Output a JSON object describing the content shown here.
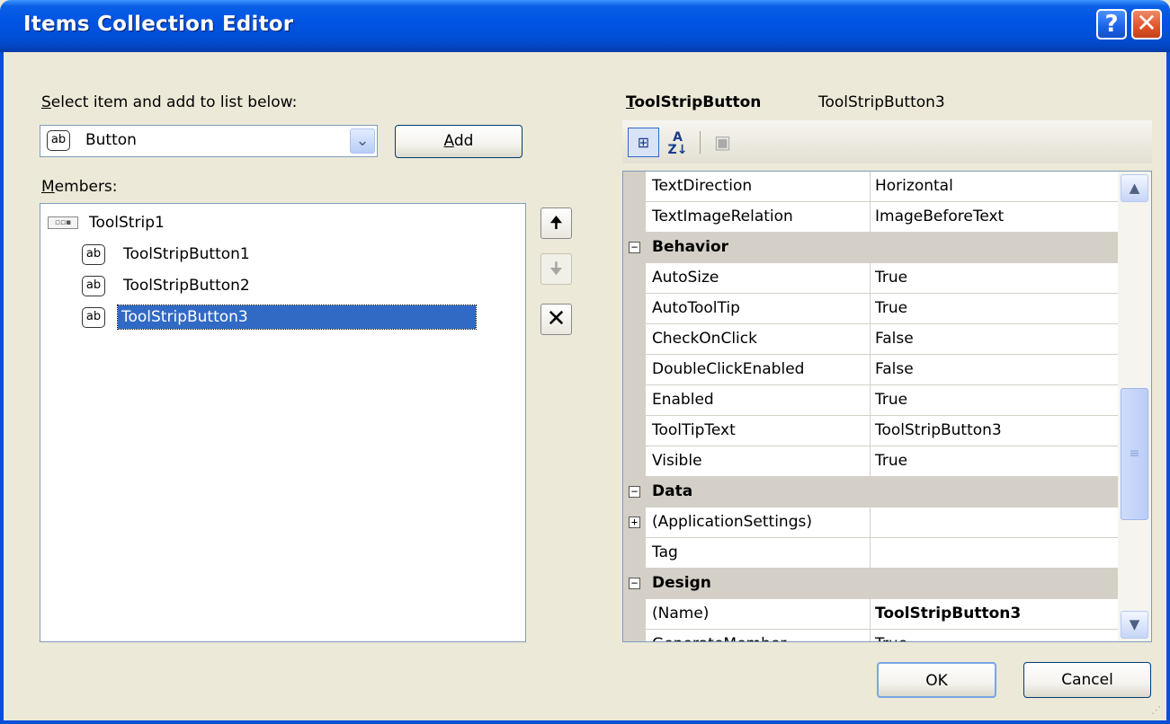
{
  "window": {
    "title": "Items Collection Editor",
    "help_glyph": "?",
    "close_glyph": "✕"
  },
  "left": {
    "select_label_accel": "S",
    "select_label_rest": "elect item and add to list below:",
    "combo_icon": "ab",
    "combo_value": "Button",
    "combo_arrow": "⌄",
    "add_accel": "A",
    "add_rest": "dd",
    "members_label_accel": "M",
    "members_label_rest": "embers:",
    "tree": {
      "root_icon": "▫▫▪",
      "root_label": "ToolStrip1",
      "items": [
        {
          "icon": "ab",
          "label": "ToolStripButton1"
        },
        {
          "icon": "ab",
          "label": "ToolStripButton2"
        },
        {
          "icon": "ab",
          "label": "ToolStripButton3"
        }
      ]
    },
    "side_buttons": {
      "up": "🠉",
      "down": "🠋",
      "delete": "✕"
    }
  },
  "right": {
    "header_type_accel": "T",
    "header_type_rest": "oolStripButton",
    "header_name": "ToolStripButton3",
    "toolbar": {
      "categorized": "⊞",
      "alpha_top": "A",
      "alpha_bottom": "Z↓",
      "pages": "▣"
    },
    "rows": [
      {
        "type": "prop",
        "name": "TextDirection",
        "value": "Horizontal"
      },
      {
        "type": "prop",
        "name": "TextImageRelation",
        "value": "ImageBeforeText"
      },
      {
        "type": "cat",
        "name": "Behavior",
        "expander": "−"
      },
      {
        "type": "prop",
        "name": "AutoSize",
        "value": "True"
      },
      {
        "type": "prop",
        "name": "AutoToolTip",
        "value": "True"
      },
      {
        "type": "prop",
        "name": "CheckOnClick",
        "value": "False"
      },
      {
        "type": "prop",
        "name": "DoubleClickEnabled",
        "value": "False"
      },
      {
        "type": "prop",
        "name": "Enabled",
        "value": "True"
      },
      {
        "type": "prop",
        "name": "ToolTipText",
        "value": "ToolStripButton3"
      },
      {
        "type": "prop",
        "name": "Visible",
        "value": "True"
      },
      {
        "type": "cat",
        "name": "Data",
        "expander": "−"
      },
      {
        "type": "prop",
        "name": "(ApplicationSettings)",
        "value": "",
        "expander": "+"
      },
      {
        "type": "prop",
        "name": "Tag",
        "value": ""
      },
      {
        "type": "cat",
        "name": "Design",
        "expander": "−"
      },
      {
        "type": "prop",
        "name": "(Name)",
        "value": "ToolStripButton3",
        "bold": true
      },
      {
        "type": "prop",
        "name": "GenerateMember",
        "value": "True"
      }
    ],
    "scroll": {
      "up": "▲",
      "down": "▼",
      "thumb": "≡"
    }
  },
  "buttons": {
    "ok": "OK",
    "cancel": "Cancel"
  },
  "grip": "⋰"
}
